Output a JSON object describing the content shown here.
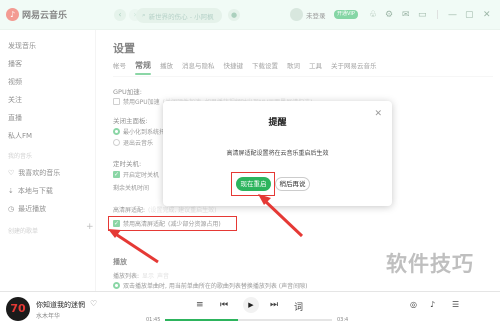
{
  "app": {
    "name": "网易云音乐"
  },
  "search": {
    "placeholder": "新世界的伤心 - 小阿枫"
  },
  "user": {
    "login_label": "未登录",
    "vip_label": "开通VIP"
  },
  "sidebar": {
    "items": [
      {
        "label": "发现音乐"
      },
      {
        "label": "播客"
      },
      {
        "label": "视频"
      },
      {
        "label": "关注"
      },
      {
        "label": "直播"
      },
      {
        "label": "私人FM"
      }
    ],
    "my_music_label": "我的音乐",
    "my_items": [
      {
        "label": "我喜欢的音乐",
        "icon": "heart-icon"
      },
      {
        "label": "本地与下载",
        "icon": "download-icon"
      },
      {
        "label": "最近播放",
        "icon": "clock-icon"
      }
    ],
    "created_playlists_label": "创建的歌单"
  },
  "settings": {
    "title": "设置",
    "tabs": [
      "帐号",
      "常规",
      "播放",
      "消息与隐私",
      "快捷键",
      "下载设置",
      "歌词",
      "工具",
      "关于网易云音乐"
    ],
    "active_tab": "常规",
    "gpu_heading": "GPU加速:",
    "gpu_option": "禁用GPU加速",
    "gpu_hint": "(关闭硬件加速, 如果播放视频时出现MV画面黑屏请勾选)",
    "close_heading": "关闭主面板:",
    "close_opt_minimize": "最小化到系统托盘",
    "close_opt_exit": "退出云音乐",
    "timer_heading": "定时关机:",
    "timer_option": "开启定时关机",
    "timer_sub": "剩余关机时间",
    "adapt_heading": "高清屏适配:",
    "adapt_sub": "(设置完成, 建议重启生效)",
    "adapt_option": "禁用高清屏适配",
    "adapt_hint": "(减少部分资源占用)",
    "play_heading": "播放",
    "playlist_heading": "播放列表:",
    "playlist_opt_a": "显示",
    "playlist_opt_b": "声音",
    "dblclick_option": "双击播放单曲时, 用当前单曲所在的歌曲列表替换播放列表 (声音间隙)"
  },
  "dialog": {
    "title": "提醒",
    "message": "高清屏适配设置将在云音乐重启后生效",
    "primary_button": "现在重启",
    "secondary_button": "稍后再说"
  },
  "player": {
    "song": "你知道我的迷惘",
    "artist": "水木年华",
    "current_time": "01:45",
    "total_time": "03:4",
    "progress": 0.44
  },
  "watermark": "软件技巧",
  "colors": {
    "accent": "#2db45d",
    "highlight": "#e53935",
    "topbar": "#e6f7ee"
  }
}
